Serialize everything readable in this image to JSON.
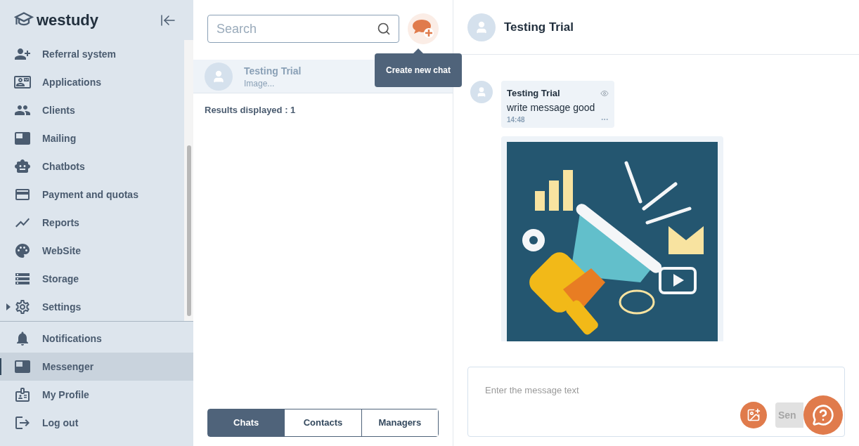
{
  "sidebar": {
    "logo": "westudy",
    "menu": [
      {
        "label": "Referral system",
        "selected": false
      },
      {
        "label": "Applications",
        "selected": false
      },
      {
        "label": "Clients",
        "selected": false
      },
      {
        "label": "Mailing",
        "selected": false
      },
      {
        "label": "Chatbots",
        "selected": false
      },
      {
        "label": "Payment and quotas",
        "selected": false
      },
      {
        "label": "Reports",
        "selected": false
      },
      {
        "label": "WebSite",
        "selected": false
      },
      {
        "label": "Storage",
        "selected": false
      },
      {
        "label": "Settings",
        "selected": false,
        "expanded": false
      }
    ],
    "bottom": [
      {
        "label": "Notifications",
        "selected": false
      },
      {
        "label": "Messenger",
        "selected": true
      },
      {
        "label": "My Profile",
        "selected": false
      },
      {
        "label": "Log out",
        "selected": false
      }
    ]
  },
  "chat_list": {
    "search": {
      "placeholder": "Search"
    },
    "tooltip": "Create new chat",
    "chats": [
      {
        "name": "Testing Trial",
        "preview": "Image...",
        "selected": true
      }
    ],
    "results": "Results displayed : 1",
    "tabs": [
      {
        "label": "Chats",
        "selected": true
      },
      {
        "label": "Contacts",
        "selected": false
      },
      {
        "label": "Managers",
        "selected": false
      }
    ]
  },
  "conversation": {
    "title": "Testing Trial",
    "messages": [
      {
        "kind": "text",
        "sender": "Testing Trial",
        "text": "write message good",
        "time": "14:48"
      },
      {
        "kind": "picture"
      }
    ],
    "composer": {
      "placeholder": "Enter the message text",
      "send": "Sen"
    }
  }
}
